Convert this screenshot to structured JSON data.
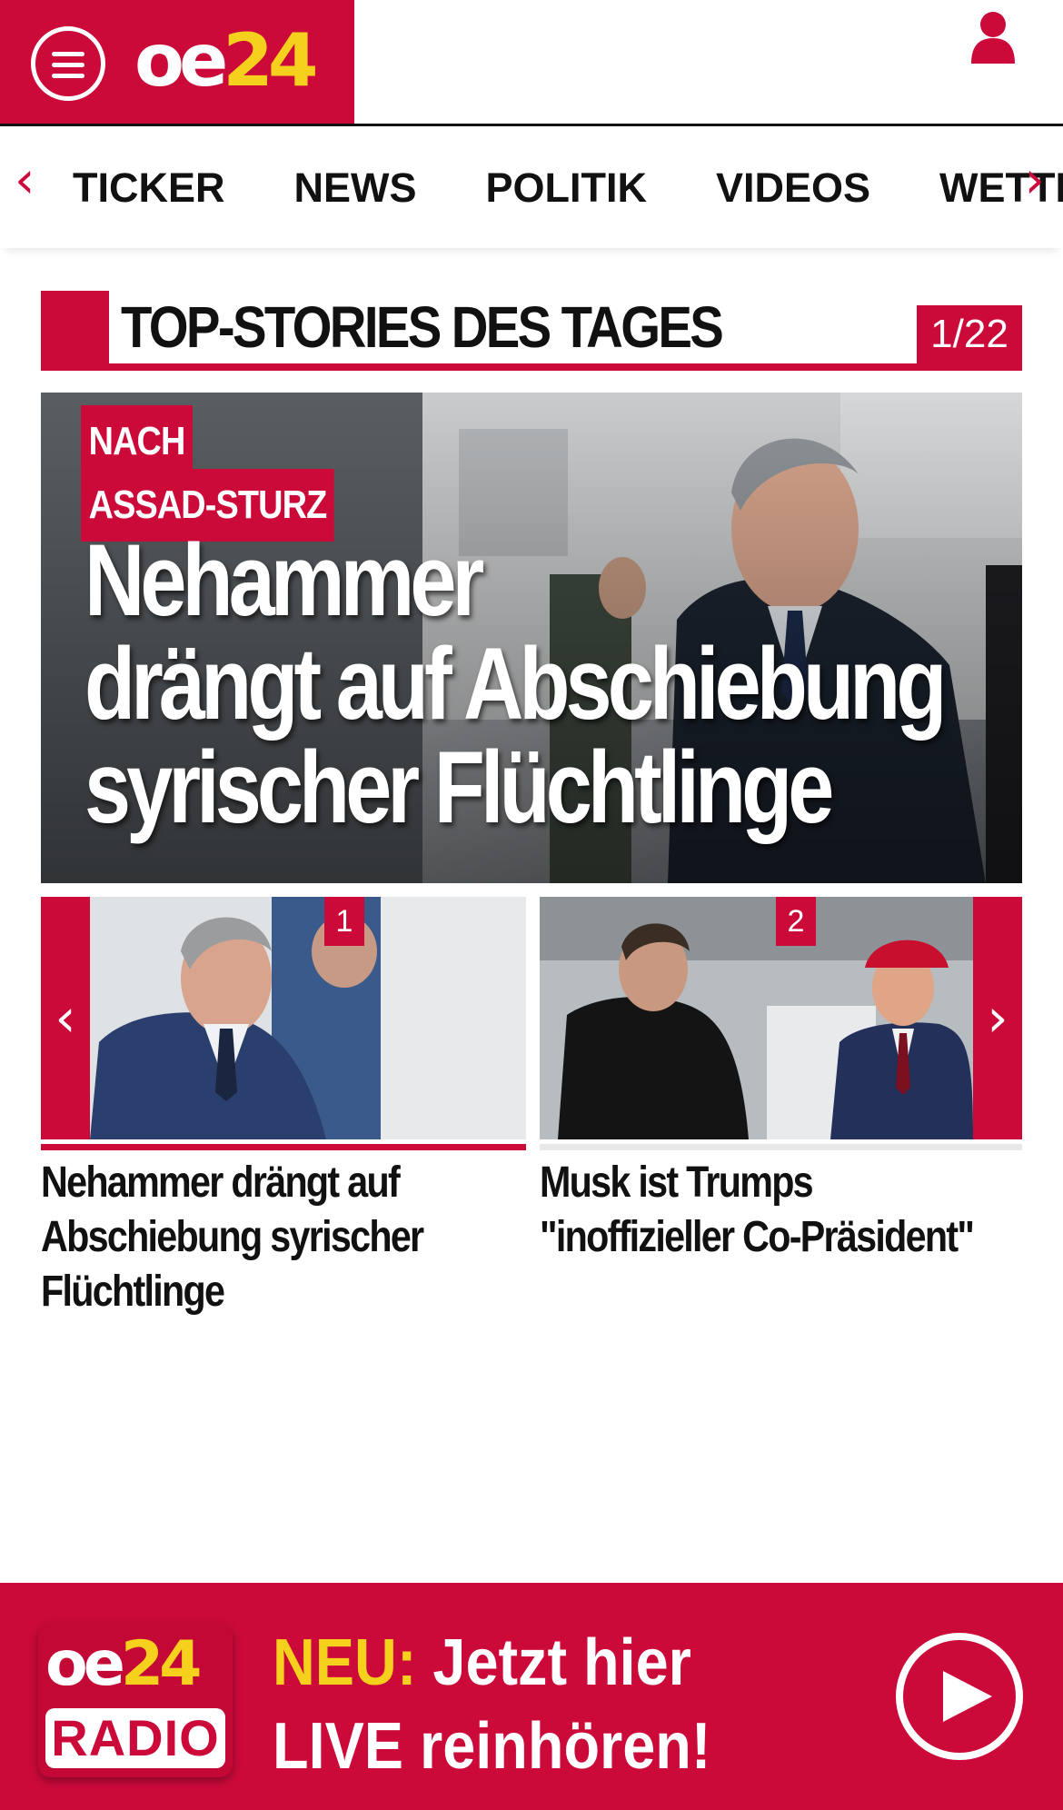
{
  "header": {
    "logo_oe": "oe",
    "logo_24": "24"
  },
  "nav": {
    "prev_arrow": "‹",
    "next_arrow": "›",
    "items": [
      "TICKER",
      "NEWS",
      "POLITIK",
      "VIDEOS",
      "WETTER"
    ]
  },
  "section": {
    "title": "TOP-STORIES DES TAGES",
    "counter": "1/22"
  },
  "hero": {
    "kicker_line1": "NACH",
    "kicker_line2": "ASSAD-STURZ",
    "headline_line1": "Nehammer",
    "headline_line2": "drängt auf Abschiebung",
    "headline_line3": "syrischer Flüchtlinge"
  },
  "carousel": {
    "prev_arrow": "‹",
    "next_arrow": "›",
    "stories": [
      {
        "num": "1",
        "title_line1": "Nehammer drängt auf",
        "title_line2": "Abschiebung syrischer",
        "title_line3": "Flüchtlinge"
      },
      {
        "num": "2",
        "title_line1": "Musk ist Trumps",
        "title_line2": "\"inoffizieller Co-Präsident\"",
        "title_line3": ""
      }
    ]
  },
  "radio": {
    "logo_oe": "oe",
    "logo_24": "24",
    "logo_radio": "RADIO",
    "neu": "NEU:",
    "line1": " Jetzt hier",
    "line2": "LIVE reinhören!"
  },
  "colors": {
    "brand_red": "#cc0a3a",
    "brand_yellow": "#f5d11e"
  }
}
